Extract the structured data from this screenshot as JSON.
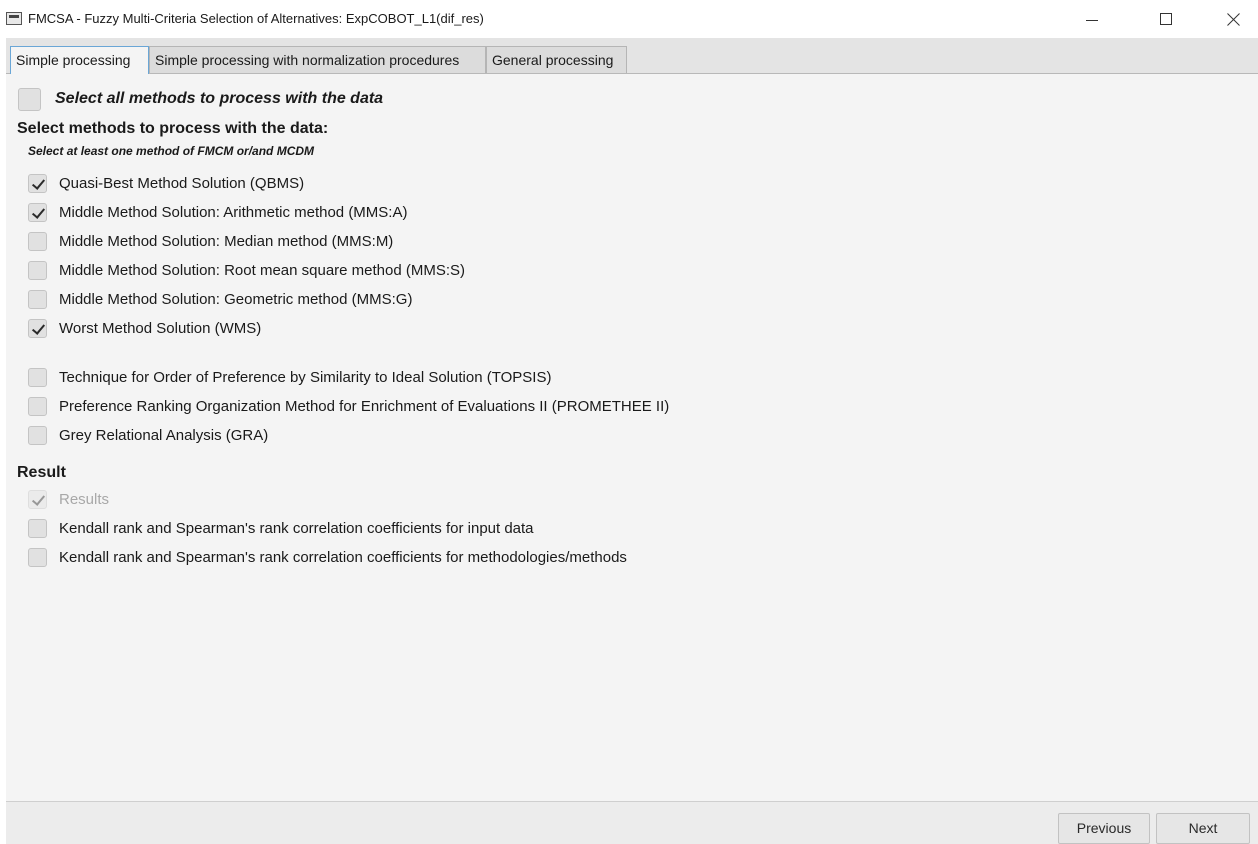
{
  "window": {
    "title": "FMCSA - Fuzzy Multi-Criteria Selection of Alternatives: ExpCOBOT_L1(dif_res)",
    "icons": [
      "app-icon",
      "minimize-icon",
      "maximize-icon",
      "close-icon"
    ]
  },
  "tabs": [
    {
      "label": "Simple processing",
      "active": true
    },
    {
      "label": "Simple processing with normalization procedures",
      "active": false
    },
    {
      "label": "General processing",
      "active": false
    }
  ],
  "select_all": {
    "label": "Select all methods to process with the data",
    "checked": false
  },
  "methods_heading": "Select methods to process with the data:",
  "methods_subheading": "Select at least one method of FMCM or/and MCDM",
  "fmcm_methods": [
    {
      "label": "Quasi-Best Method Solution (QBMS)",
      "checked": true
    },
    {
      "label": "Middle Method Solution: Arithmetic method (MMS:A)",
      "checked": true
    },
    {
      "label": "Middle Method Solution: Median method (MMS:M)",
      "checked": false
    },
    {
      "label": "Middle Method Solution: Root mean square method (MMS:S)",
      "checked": false
    },
    {
      "label": "Middle Method Solution: Geometric method (MMS:G)",
      "checked": false
    },
    {
      "label": "Worst Method Solution (WMS)",
      "checked": true
    }
  ],
  "mcdm_methods": [
    {
      "label": "Technique for Order of Preference by Similarity to Ideal Solution (TOPSIS)",
      "checked": false
    },
    {
      "label": "Preference Ranking Organization Method for Enrichment of Evaluations II (PROMETHEE II)",
      "checked": false
    },
    {
      "label": "Grey Relational Analysis (GRA)",
      "checked": false
    }
  ],
  "result_heading": "Result",
  "result_options": [
    {
      "label": "Results",
      "checked": true,
      "disabled": true
    },
    {
      "label": "Kendall rank and Spearman's rank correlation coefficients for input data",
      "checked": false,
      "disabled": false
    },
    {
      "label": "Kendall rank and Spearman's rank correlation coefficients for methodologies/methods",
      "checked": false,
      "disabled": false
    }
  ],
  "footer": {
    "previous_label": "Previous",
    "next_label": "Next"
  },
  "colors": {
    "active_tab_border": "#6aa6d6",
    "background": "#f4f4f4"
  }
}
